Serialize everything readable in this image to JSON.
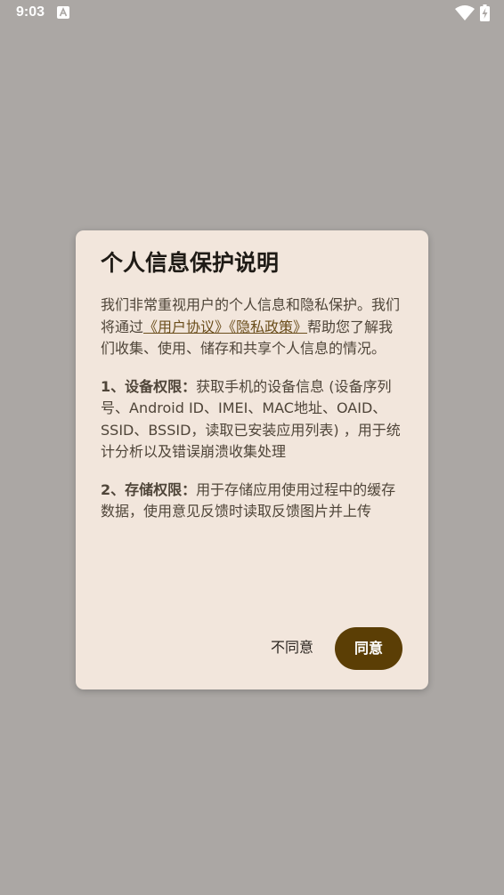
{
  "status_bar": {
    "time": "9:03",
    "icons": [
      "notification-a-icon",
      "wifi-icon",
      "battery-charging-icon"
    ]
  },
  "dialog": {
    "title": "个人信息保护说明",
    "intro": {
      "before": "我们非常重视用户的个人信息和隐私保护。我们将通过",
      "link_user_agreement": "《用户协议》",
      "link_privacy_policy": "《隐私政策》",
      "after": "帮助您了解我们收集、使用、储存和共享个人信息的情况。"
    },
    "permissions": [
      {
        "title": "1、设备权限：",
        "text": "获取手机的设备信息 (设备序列号、Android ID、IMEI、MAC地址、OAID、SSID、BSSID，读取已安装应用列表) ，用于统计分析以及错误崩溃收集处理"
      },
      {
        "title": "2、存储权限：",
        "text": "用于存储应用使用过程中的缓存数据，使用意见反馈时读取反馈图片并上传"
      }
    ],
    "buttons": {
      "disagree": "不同意",
      "agree": "同意"
    }
  },
  "colors": {
    "scrim": "#aba7a4",
    "dialog_bg": "#f2e6dc",
    "primary": "#5b3e05",
    "link": "#6b4e1c"
  }
}
